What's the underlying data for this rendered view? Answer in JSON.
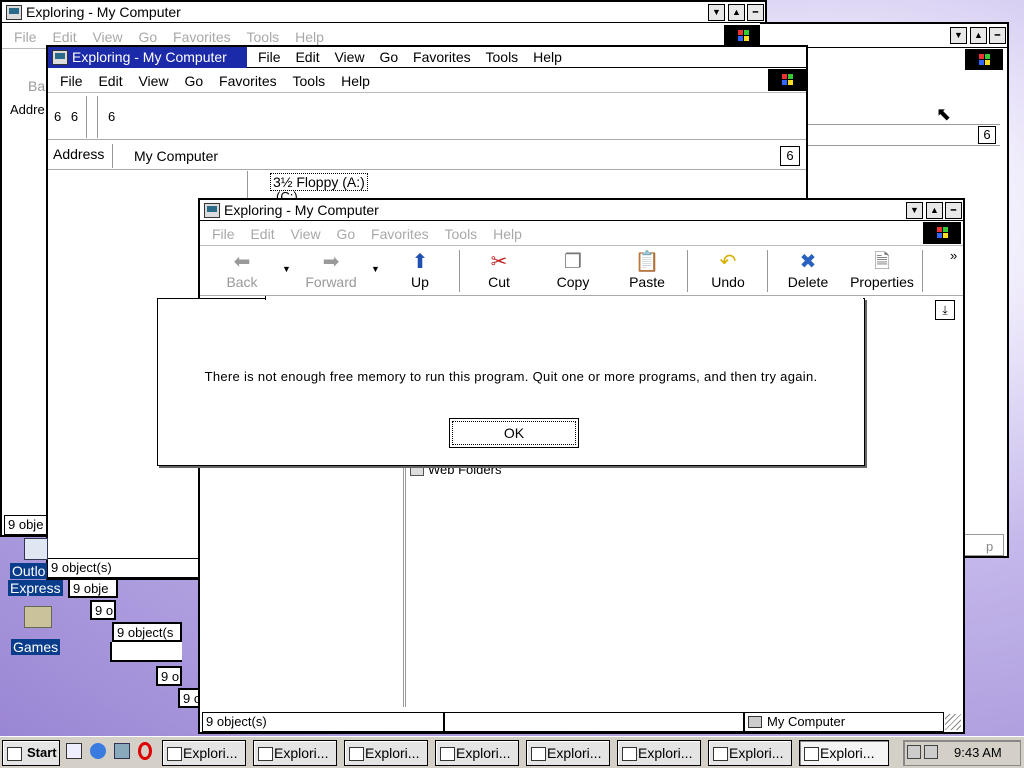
{
  "desktop": {
    "icons": [
      {
        "name": "Outlook Express",
        "lines": [
          "Outlo",
          "Express"
        ],
        "icon": "outlook-express-icon"
      },
      {
        "name": "Games",
        "lines": [
          "Games"
        ],
        "icon": "games-folder-icon"
      }
    ]
  },
  "window_back": {
    "title": "Exploring - My Computer",
    "menu": [
      "File",
      "Edit",
      "View",
      "Go",
      "Favorites",
      "Tools",
      "Help"
    ],
    "back_partial": "Ba",
    "address_partial": "Addre",
    "address_dropdown": "6",
    "status": "9 obje",
    "scroll_label": "p"
  },
  "window_mid": {
    "title": "Exploring - My Computer",
    "menu1": [
      "File",
      "Edit",
      "View",
      "Go",
      "Favorites",
      "Tools",
      "Help"
    ],
    "menu2": [
      "File",
      "Edit",
      "View",
      "Go",
      "Favorites",
      "Tools",
      "Help"
    ],
    "toolbar_glyphs": [
      "6",
      "6",
      "6"
    ],
    "address_label": "Address",
    "address_value": "My Computer",
    "address_dropdown": "6",
    "tree_item_1": "3½ Floppy (A:)",
    "tree_item_2": "(C:)",
    "status": "9 object(s)"
  },
  "cascade_statuses": [
    "9 obje",
    "9 o",
    "9 object(s",
    "9 o",
    "9 o"
  ],
  "window_front": {
    "title": "Exploring - My Computer",
    "menu": [
      "File",
      "Edit",
      "View",
      "Go",
      "Favorites",
      "Tools",
      "Help"
    ],
    "toolbar": {
      "back": "Back",
      "forward": "Forward",
      "up": "Up",
      "cut": "Cut",
      "copy": "Copy",
      "paste": "Paste",
      "undo": "Undo",
      "delete": "Delete",
      "properties": "Properties",
      "more": "»"
    },
    "list_item": "Web Folders",
    "status": "9 object(s)",
    "status_location": "My Computer"
  },
  "dialog": {
    "message": "There is not enough free memory to run this program. Quit one or more programs, and then try again.",
    "ok_label": "OK"
  },
  "taskbar": {
    "start_label": "Start",
    "quick_launch": [
      "show-desktop-icon",
      "internet-explorer-icon",
      "outlook-icon",
      "opera-icon"
    ],
    "tasks": [
      "Explori...",
      "Explori...",
      "Explori...",
      "Explori...",
      "Explori...",
      "Explori...",
      "Explori...",
      "Explori..."
    ],
    "clock": "9:43 AM"
  }
}
